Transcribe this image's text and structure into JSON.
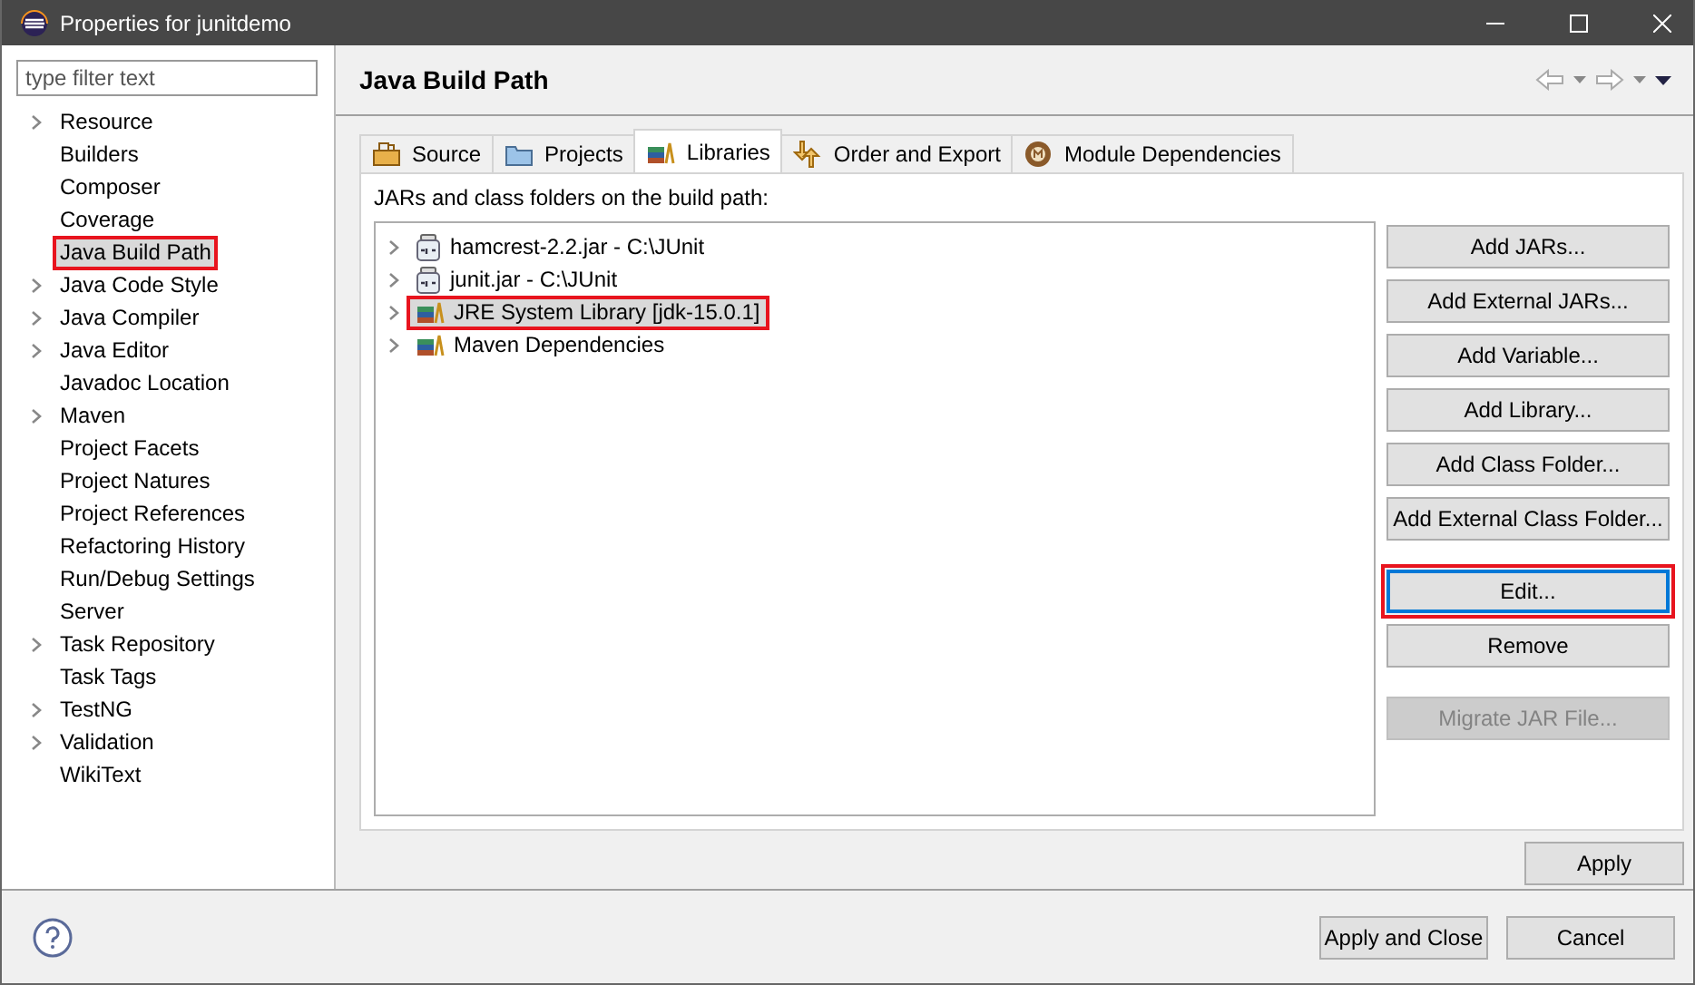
{
  "window": {
    "title": "Properties for junitdemo"
  },
  "filter": {
    "placeholder": "type filter text"
  },
  "sidebar": {
    "items": [
      {
        "label": "Resource",
        "expandable": true,
        "selected": false,
        "highlighted": false
      },
      {
        "label": "Builders",
        "expandable": false,
        "selected": false,
        "highlighted": false
      },
      {
        "label": "Composer",
        "expandable": false,
        "selected": false,
        "highlighted": false
      },
      {
        "label": "Coverage",
        "expandable": false,
        "selected": false,
        "highlighted": false
      },
      {
        "label": "Java Build Path",
        "expandable": false,
        "selected": true,
        "highlighted": true
      },
      {
        "label": "Java Code Style",
        "expandable": true,
        "selected": false,
        "highlighted": false
      },
      {
        "label": "Java Compiler",
        "expandable": true,
        "selected": false,
        "highlighted": false
      },
      {
        "label": "Java Editor",
        "expandable": true,
        "selected": false,
        "highlighted": false
      },
      {
        "label": "Javadoc Location",
        "expandable": false,
        "selected": false,
        "highlighted": false
      },
      {
        "label": "Maven",
        "expandable": true,
        "selected": false,
        "highlighted": false
      },
      {
        "label": "Project Facets",
        "expandable": false,
        "selected": false,
        "highlighted": false
      },
      {
        "label": "Project Natures",
        "expandable": false,
        "selected": false,
        "highlighted": false
      },
      {
        "label": "Project References",
        "expandable": false,
        "selected": false,
        "highlighted": false
      },
      {
        "label": "Refactoring History",
        "expandable": false,
        "selected": false,
        "highlighted": false
      },
      {
        "label": "Run/Debug Settings",
        "expandable": false,
        "selected": false,
        "highlighted": false
      },
      {
        "label": "Server",
        "expandable": false,
        "selected": false,
        "highlighted": false
      },
      {
        "label": "Task Repository",
        "expandable": true,
        "selected": false,
        "highlighted": false
      },
      {
        "label": "Task Tags",
        "expandable": false,
        "selected": false,
        "highlighted": false
      },
      {
        "label": "TestNG",
        "expandable": true,
        "selected": false,
        "highlighted": false
      },
      {
        "label": "Validation",
        "expandable": true,
        "selected": false,
        "highlighted": false
      },
      {
        "label": "WikiText",
        "expandable": false,
        "selected": false,
        "highlighted": false
      }
    ]
  },
  "page": {
    "title": "Java Build Path"
  },
  "tabs": [
    {
      "label": "Source",
      "kind": "source",
      "selected": false
    },
    {
      "label": "Projects",
      "kind": "projects",
      "selected": false
    },
    {
      "label": "Libraries",
      "kind": "libraries",
      "selected": true
    },
    {
      "label": "Order and Export",
      "kind": "order",
      "selected": false
    },
    {
      "label": "Module Dependencies",
      "kind": "module",
      "selected": false
    }
  ],
  "build_path": {
    "caption": "JARs and class folders on the build path:",
    "rows": [
      {
        "label": "hamcrest-2.2.jar - C:\\JUnit",
        "kind": "jar",
        "selected": false,
        "highlighted": false
      },
      {
        "label": "junit.jar - C:\\JUnit",
        "kind": "jar",
        "selected": false,
        "highlighted": false
      },
      {
        "label": "JRE System Library [jdk-15.0.1]",
        "kind": "library",
        "selected": true,
        "highlighted": true
      },
      {
        "label": "Maven Dependencies",
        "kind": "library",
        "selected": false,
        "highlighted": false
      }
    ]
  },
  "buttons": [
    {
      "label": "Add JARs...",
      "separated": false,
      "disabled": false,
      "focused": false,
      "highlighted": false
    },
    {
      "label": "Add External JARs...",
      "separated": false,
      "disabled": false,
      "focused": false,
      "highlighted": false
    },
    {
      "label": "Add Variable...",
      "separated": false,
      "disabled": false,
      "focused": false,
      "highlighted": false
    },
    {
      "label": "Add Library...",
      "separated": false,
      "disabled": false,
      "focused": false,
      "highlighted": false
    },
    {
      "label": "Add Class Folder...",
      "separated": false,
      "disabled": false,
      "focused": false,
      "highlighted": false
    },
    {
      "label": "Add External Class Folder...",
      "separated": false,
      "disabled": false,
      "focused": false,
      "highlighted": false
    },
    {
      "label": "Edit...",
      "separated": true,
      "disabled": false,
      "focused": true,
      "highlighted": true
    },
    {
      "label": "Remove",
      "separated": false,
      "disabled": false,
      "focused": false,
      "highlighted": false
    },
    {
      "label": "Migrate JAR File...",
      "separated": true,
      "disabled": true,
      "focused": false,
      "highlighted": false
    }
  ],
  "apply_button": "Apply",
  "footer_buttons": [
    "Apply and Close",
    "Cancel"
  ]
}
